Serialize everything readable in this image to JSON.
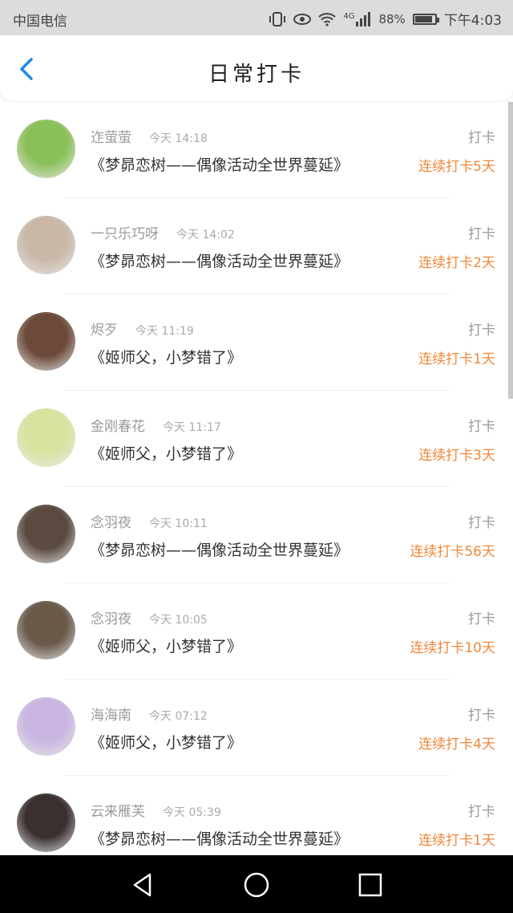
{
  "status_bar": {
    "carrier": "中国电信",
    "network": "4G",
    "battery": "88%",
    "battery_level": 0.88,
    "time": "下午4:03"
  },
  "header": {
    "title": "日常打卡",
    "back_icon": "chevron-left-icon"
  },
  "checkins": [
    {
      "name": "迮萤萤",
      "time": "今天 14:18",
      "action": "打卡",
      "content": "《梦昴恋树——偶像活动全世界蔓延》",
      "streak": "连续打卡5天",
      "avatar_color": "#8bbf5a"
    },
    {
      "name": "一只乐巧呀",
      "time": "今天 14:02",
      "action": "打卡",
      "content": "《梦昴恋树——偶像活动全世界蔓延》",
      "streak": "连续打卡2天",
      "avatar_color": "#c9b8a8"
    },
    {
      "name": "烬歹",
      "time": "今天 11:19",
      "action": "打卡",
      "content": "《姬师父，小梦错了》",
      "streak": "连续打卡1天",
      "avatar_color": "#6b4a3a"
    },
    {
      "name": "金刚春花",
      "time": "今天 11:17",
      "action": "打卡",
      "content": "《姬师父，小梦错了》",
      "streak": "连续打卡3天",
      "avatar_color": "#d9e3a0"
    },
    {
      "name": "念羽夜",
      "time": "今天 10:11",
      "action": "打卡",
      "content": "《梦昴恋树——偶像活动全世界蔓延》",
      "streak": "连续打卡56天",
      "avatar_color": "#5a4a40"
    },
    {
      "name": "念羽夜",
      "time": "今天 10:05",
      "action": "打卡",
      "content": "《姬师父，小梦错了》",
      "streak": "连续打卡10天",
      "avatar_color": "#6a5a4a"
    },
    {
      "name": "海海南",
      "time": "今天 07:12",
      "action": "打卡",
      "content": "《姬师父，小梦错了》",
      "streak": "连续打卡4天",
      "avatar_color": "#c9b6e0"
    },
    {
      "name": "云来雁芙",
      "time": "今天 05:39",
      "action": "打卡",
      "content": "《梦昴恋树——偶像活动全世界蔓延》",
      "streak": "连续打卡1天",
      "avatar_color": "#3a3030"
    }
  ],
  "navbar": {
    "back_icon": "triangle-back-icon",
    "home_icon": "circle-home-icon",
    "recents_icon": "square-recents-icon"
  },
  "colors": {
    "accent_blue": "#1e88e5",
    "streak_orange": "#f0883a"
  }
}
